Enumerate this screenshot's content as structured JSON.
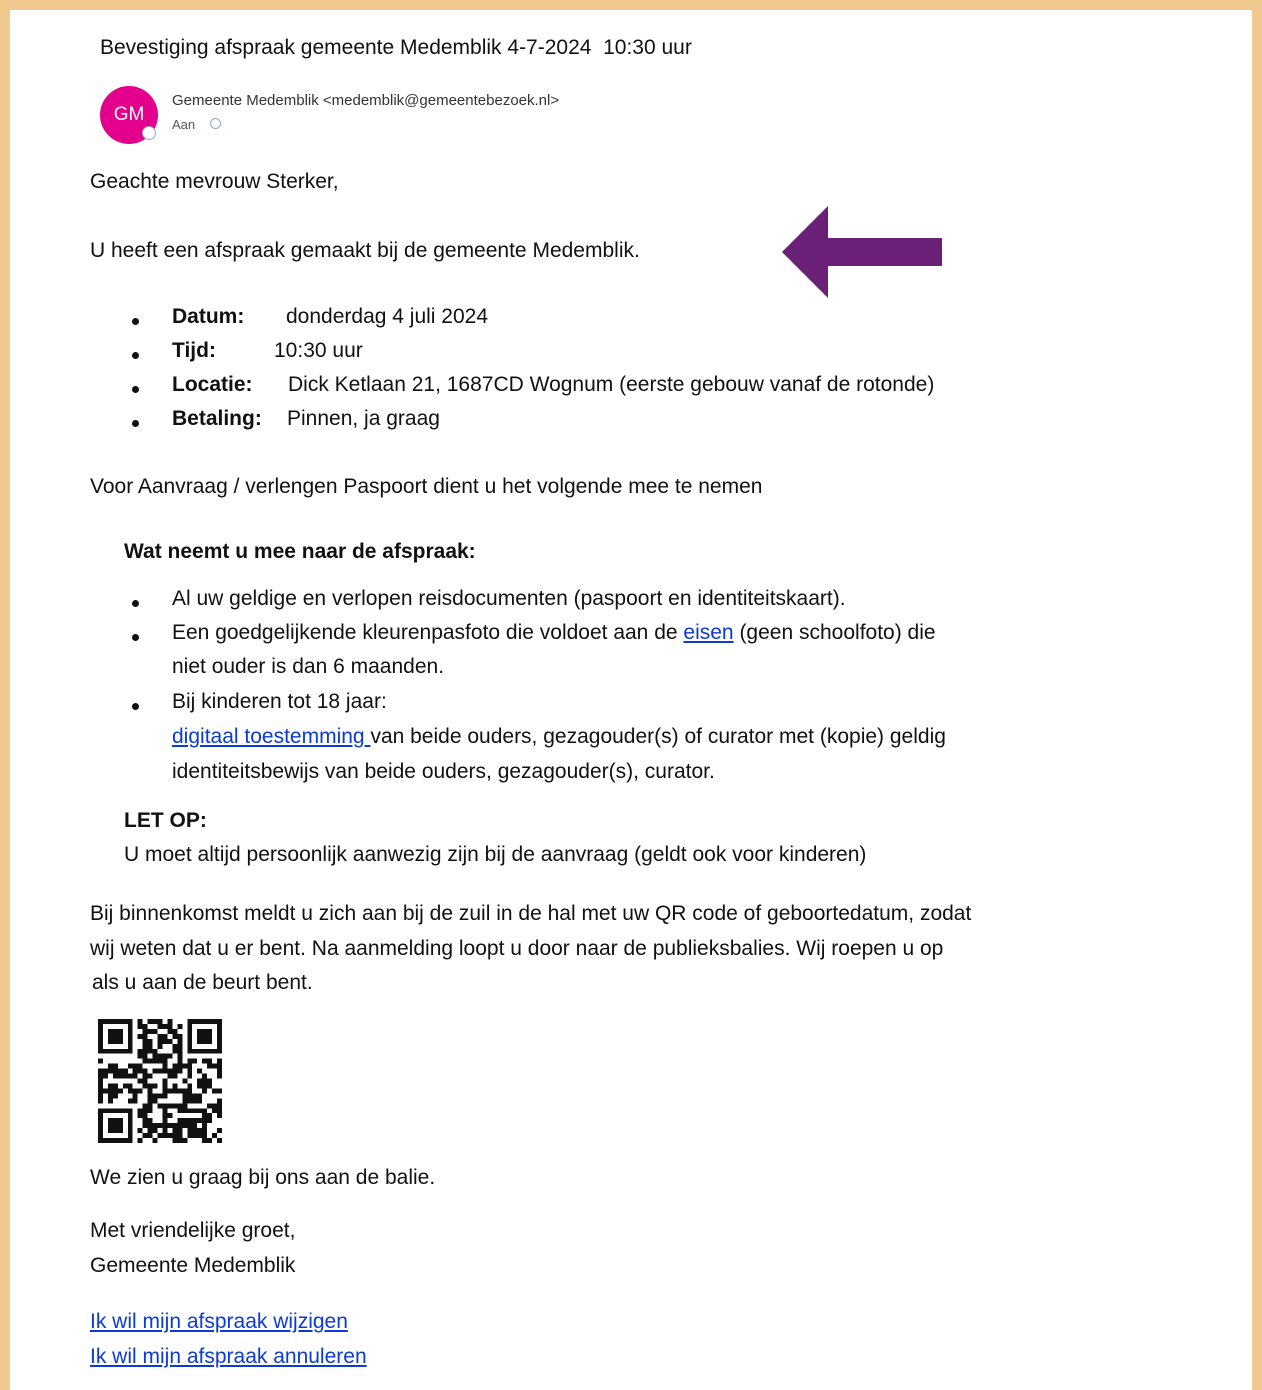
{
  "email": {
    "subject": "Bevestiging afspraak gemeente Medemblik 4-7-2024  10:30 uur",
    "avatar_initials": "GM",
    "sender": "Gemeente Medemblik <medemblik@gemeentebezoek.nl>",
    "to_label": "Aan"
  },
  "body": {
    "greeting": "Geachte mevrouw Sterker,",
    "intro": "U heeft een afspraak gemaakt bij de gemeente Medemblik.",
    "details": [
      {
        "label": "Datum:",
        "value": "donderdag 4 juli 2024"
      },
      {
        "label": "Tijd:",
        "value": "10:30 uur"
      },
      {
        "label": "Locatie:",
        "value": "Dick Ketlaan 21, 1687CD Wognum (eerste gebouw vanaf de rotonde)"
      },
      {
        "label": "Betaling:",
        "value": "Pinnen, ja graag"
      }
    ],
    "passport_intro": "Voor Aanvraag / verlengen Paspoort dient u het volgende mee te nemen",
    "bring_heading": "Wat neemt u mee naar de afspraak:",
    "bring_1": "Al uw geldige en verlopen reisdocumenten (paspoort en identiteitskaart).",
    "bring_2_pre": "Een goedgelijkende kleurenpasfoto die voldoet aan de ",
    "bring_2_link": "eisen",
    "bring_2_post": " (geen schoolfoto) die",
    "bring_2_line2": "niet ouder is dan 6 maanden.",
    "bring_3": "Bij kinderen tot 18 jaar:",
    "bring_3_link": "digitaal toestemming ",
    "bring_3_post": "van beide ouders, gezagouder(s) of curator met (kopie) geldig",
    "bring_3_line3": "identiteitsbewijs van beide ouders, gezagouder(s), curator.",
    "letop_heading": "LET OP:",
    "letop_text": "U moet altijd persoonlijk aanwezig zijn bij de aanvraag (geldt ook voor kinderen)",
    "arrival_1": "Bij binnenkomst meldt u zich aan bij de zuil in de hal met uw QR code of geboortedatum, zodat",
    "arrival_2": "wij weten dat u er bent. Na aanmelding loopt u door naar de publieksbalies. Wij roepen u op",
    "arrival_3": "als u aan de  beurt bent.",
    "see_you": "We zien u graag bij ons aan de balie.",
    "closing_1": "Met vriendelijke groet,",
    "closing_2": "Gemeente Medemblik",
    "link_change": "Ik wil mijn afspraak wijzigen",
    "link_cancel": "Ik wil mijn afspraak annuleren"
  },
  "colors": {
    "frame": "#f1c88e",
    "avatar": "#e2008d",
    "arrow": "#6b2077",
    "link": "#0b3ad6"
  }
}
